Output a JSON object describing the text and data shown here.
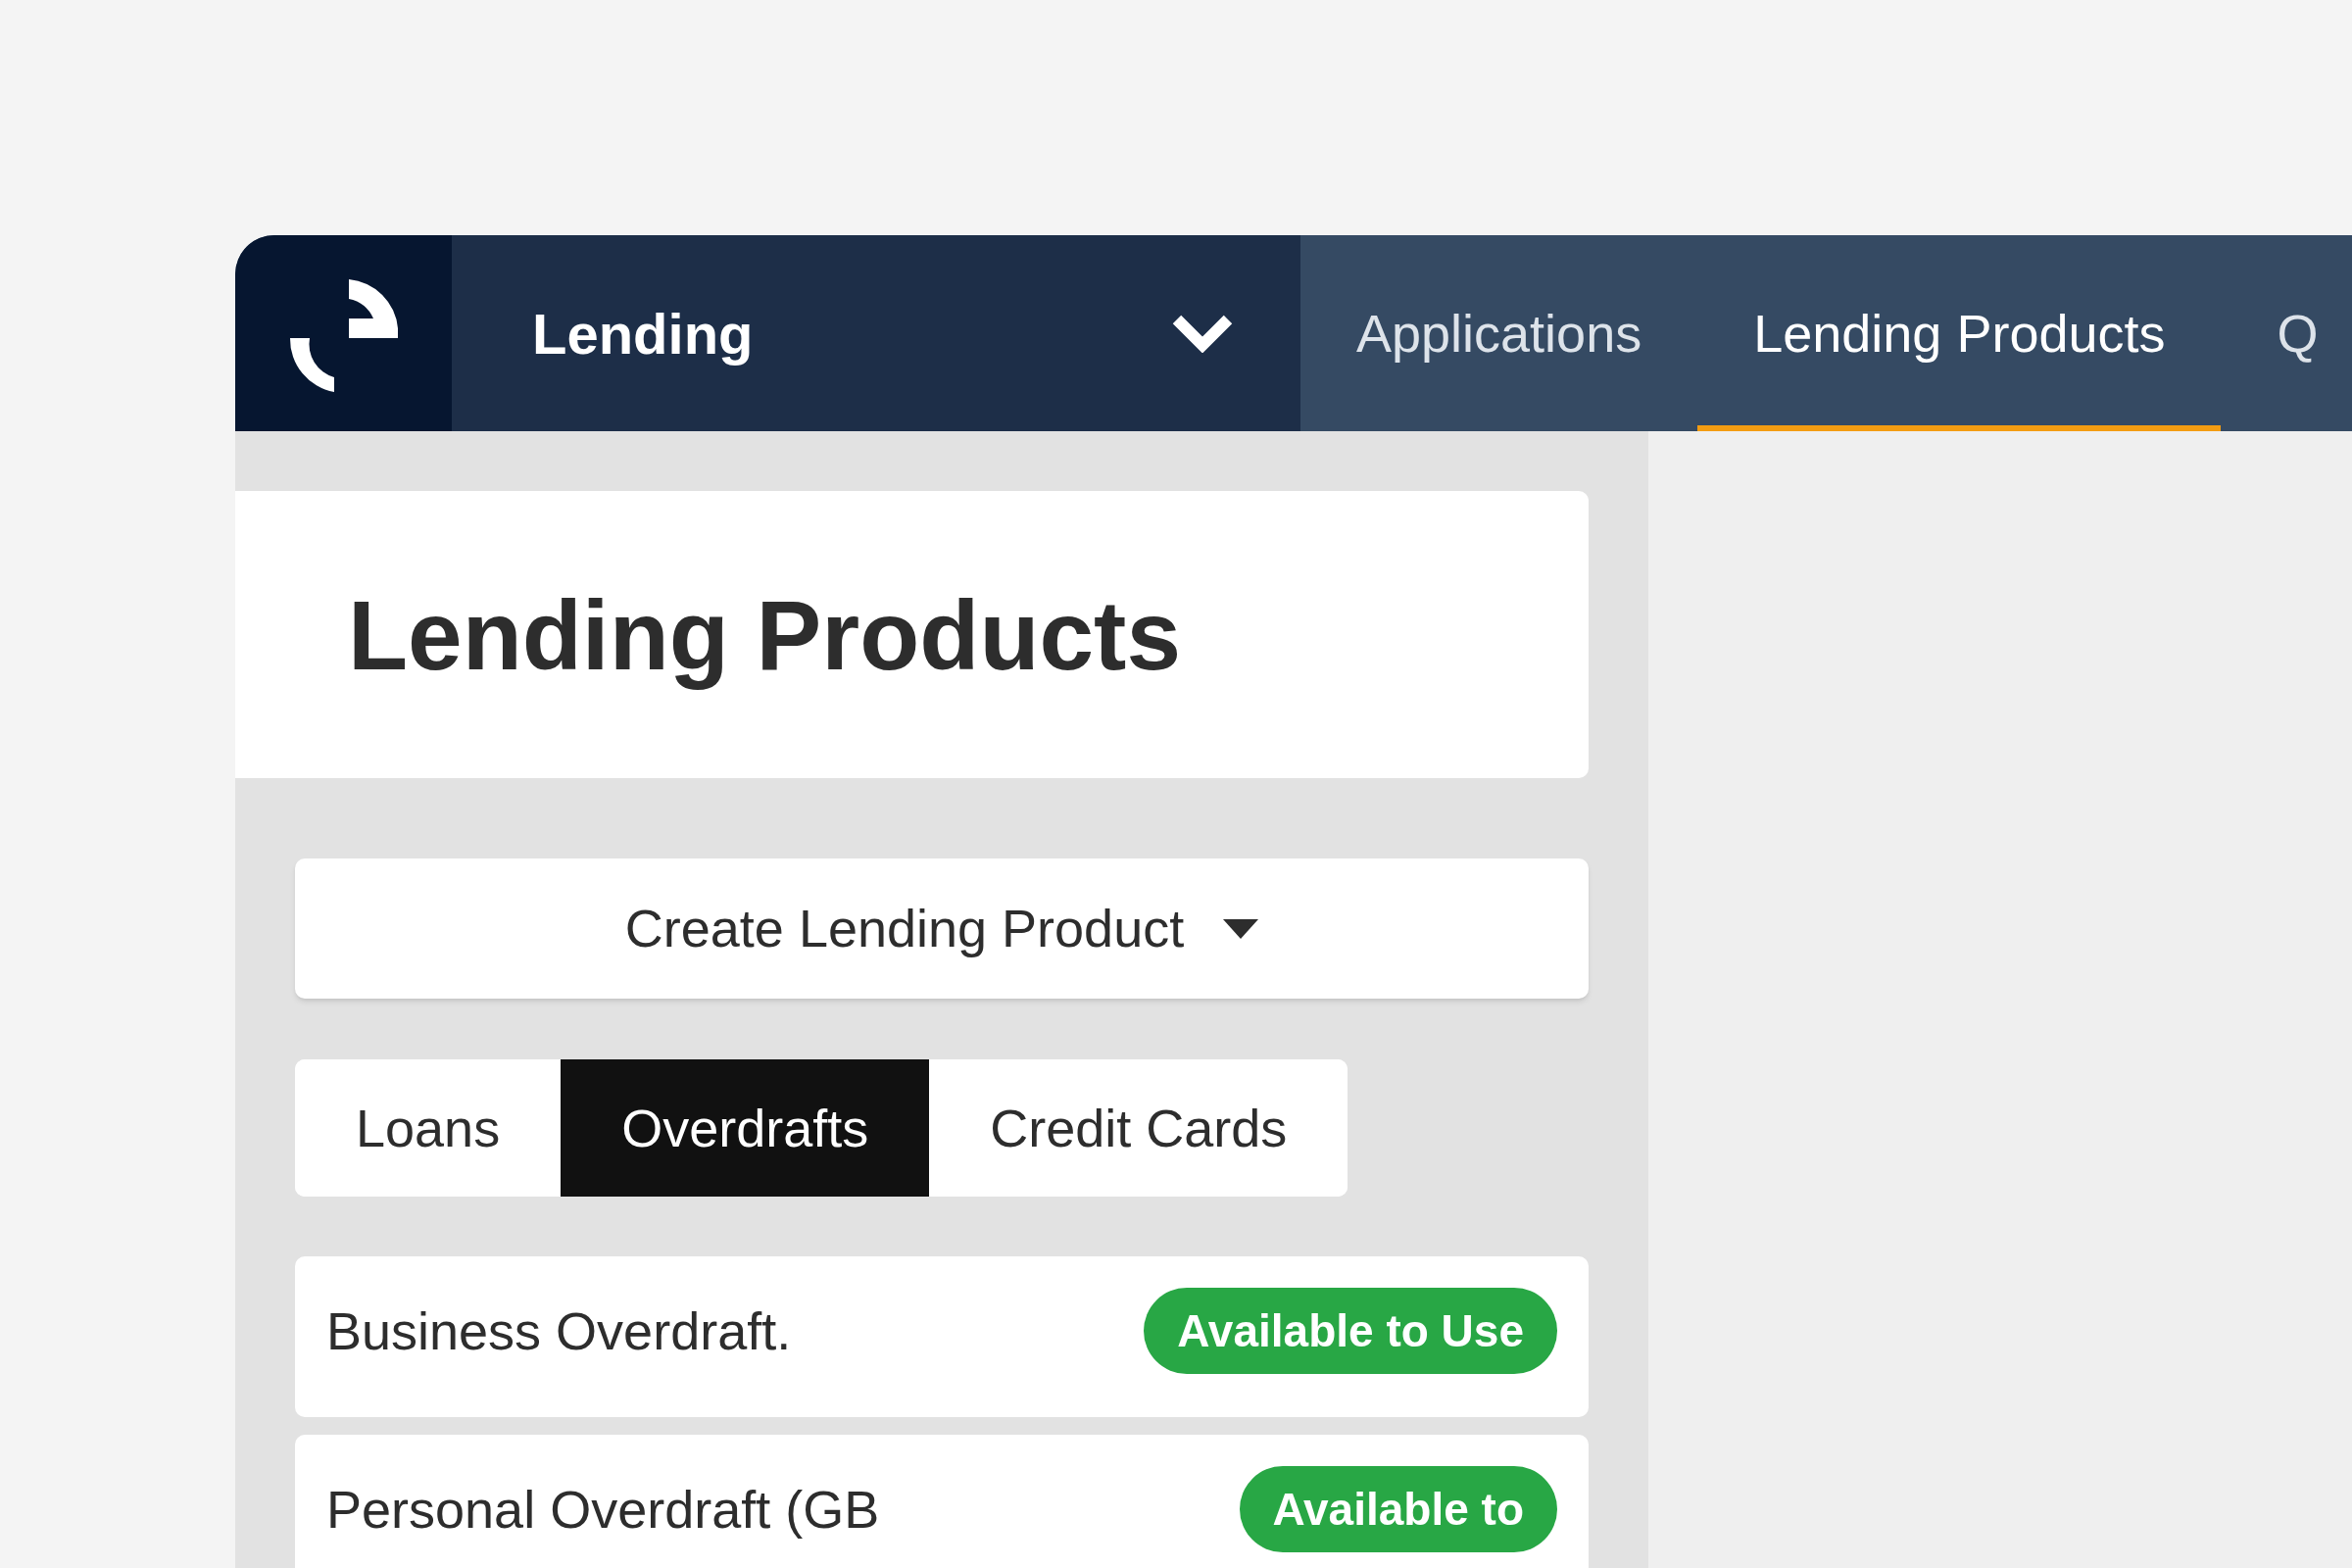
{
  "product_switcher": {
    "label": "Lending"
  },
  "nav": [
    {
      "label": "Applications",
      "selected": false
    },
    {
      "label": "Lending Products",
      "selected": true
    },
    {
      "label": "Q",
      "selected": false
    }
  ],
  "page_title": "Lending Products",
  "create_button": {
    "label": "Create Lending Product"
  },
  "tabs": [
    {
      "label": "Loans",
      "selected": false
    },
    {
      "label": "Overdrafts",
      "selected": true
    },
    {
      "label": "Credit Cards",
      "selected": false
    }
  ],
  "products": [
    {
      "name": "Business Overdraft.",
      "status": "Available to Use",
      "color": "#28a745"
    },
    {
      "name": "Personal Overdraft (GB",
      "status": "Available to",
      "color": "#28a745"
    }
  ]
}
